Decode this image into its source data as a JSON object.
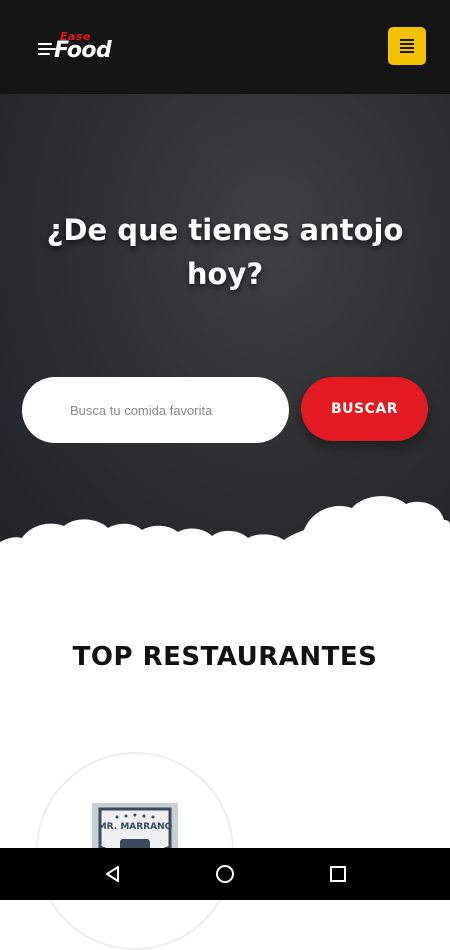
{
  "app": {
    "logo_small": "Ease",
    "logo_big": "Food"
  },
  "colors": {
    "accent_red": "#e41a23",
    "menu_yellow": "#f5c200",
    "header_bg": "#141414",
    "hero_bg": "#2c2d2f"
  },
  "hero": {
    "title_line1": "¿De que tienes antojo",
    "title_line2": "hoy?"
  },
  "search": {
    "placeholder": "Busca tu comida favorita",
    "button_label": "BUSCAR"
  },
  "section": {
    "title": "TOP RESTAURANTES"
  },
  "restaurants": [
    {
      "badge_text": "MR. MARRANO"
    }
  ],
  "icons": {
    "menu": "hamburger-icon",
    "back": "back-triangle-icon",
    "home": "home-circle-icon",
    "recents": "recents-square-icon"
  }
}
